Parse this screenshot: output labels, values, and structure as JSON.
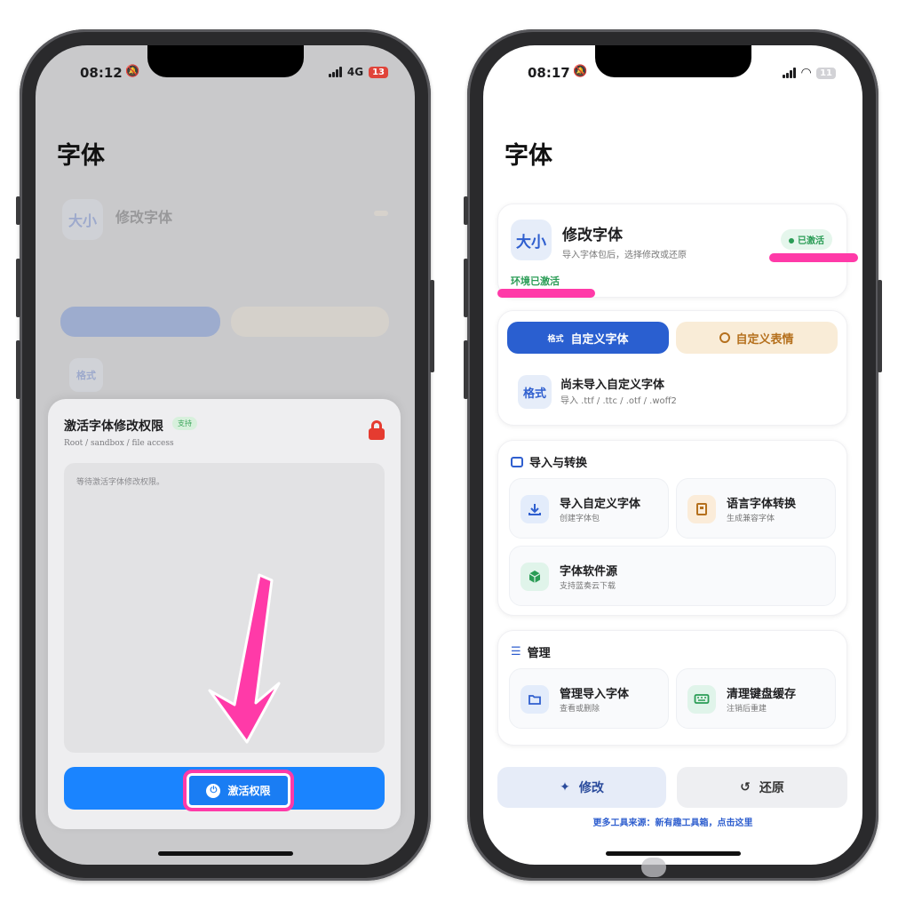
{
  "left_phone": {
    "status": {
      "time": "08:12",
      "network": "4G",
      "battery": "13"
    },
    "title": "字体",
    "header": {
      "icon_text": "大小",
      "title": "修改字体"
    },
    "format_icon": "格式",
    "sheet": {
      "title": "激活字体修改权限",
      "badge": "支持",
      "subtitle": "Root / sandbox / file access",
      "log_text": "等待激活字体修改权限。",
      "activate_button": "激活权限"
    }
  },
  "right_phone": {
    "status": {
      "time": "08:17",
      "battery": "11"
    },
    "title": "字体",
    "header": {
      "icon_text": "大小",
      "title": "修改字体",
      "subtitle": "导入字体包后，选择修改或还原",
      "status_badge": "已激活",
      "env_status": "环境已激活"
    },
    "tabs": {
      "custom_font_tag": "格式",
      "custom_font": "自定义字体",
      "custom_emoji": "自定义表情"
    },
    "font_slot": {
      "icon_text": "格式",
      "title": "尚未导入自定义字体",
      "subtitle": "导入 .ttf / .ttc / .otf / .woff2"
    },
    "import_section": {
      "heading": "导入与转换",
      "tiles": [
        {
          "title": "导入自定义字体",
          "subtitle": "创建字体包",
          "icon": "download-icon"
        },
        {
          "title": "语言字体转换",
          "subtitle": "生成兼容字体",
          "icon": "book-icon"
        },
        {
          "title": "字体软件源",
          "subtitle": "支持蓝奏云下载",
          "icon": "box-icon"
        }
      ]
    },
    "manage_section": {
      "heading": "管理",
      "tiles": [
        {
          "title": "管理导入字体",
          "subtitle": "查看或删除",
          "icon": "folder-icon"
        },
        {
          "title": "清理键盘缓存",
          "subtitle": "注销后重建",
          "icon": "keyboard-icon"
        }
      ]
    },
    "actions": {
      "modify": "修改",
      "restore": "还原"
    },
    "footer_link": "更多工具来源：新有趣工具箱，点击这里"
  },
  "colors": {
    "accent": "#2a5fd0",
    "activate_blue": "#1a84ff",
    "success_green": "#2a9c55",
    "highlight_pink": "#ff3aa8",
    "warning_orange": "#b5701d",
    "lock_red": "#e53b30"
  }
}
